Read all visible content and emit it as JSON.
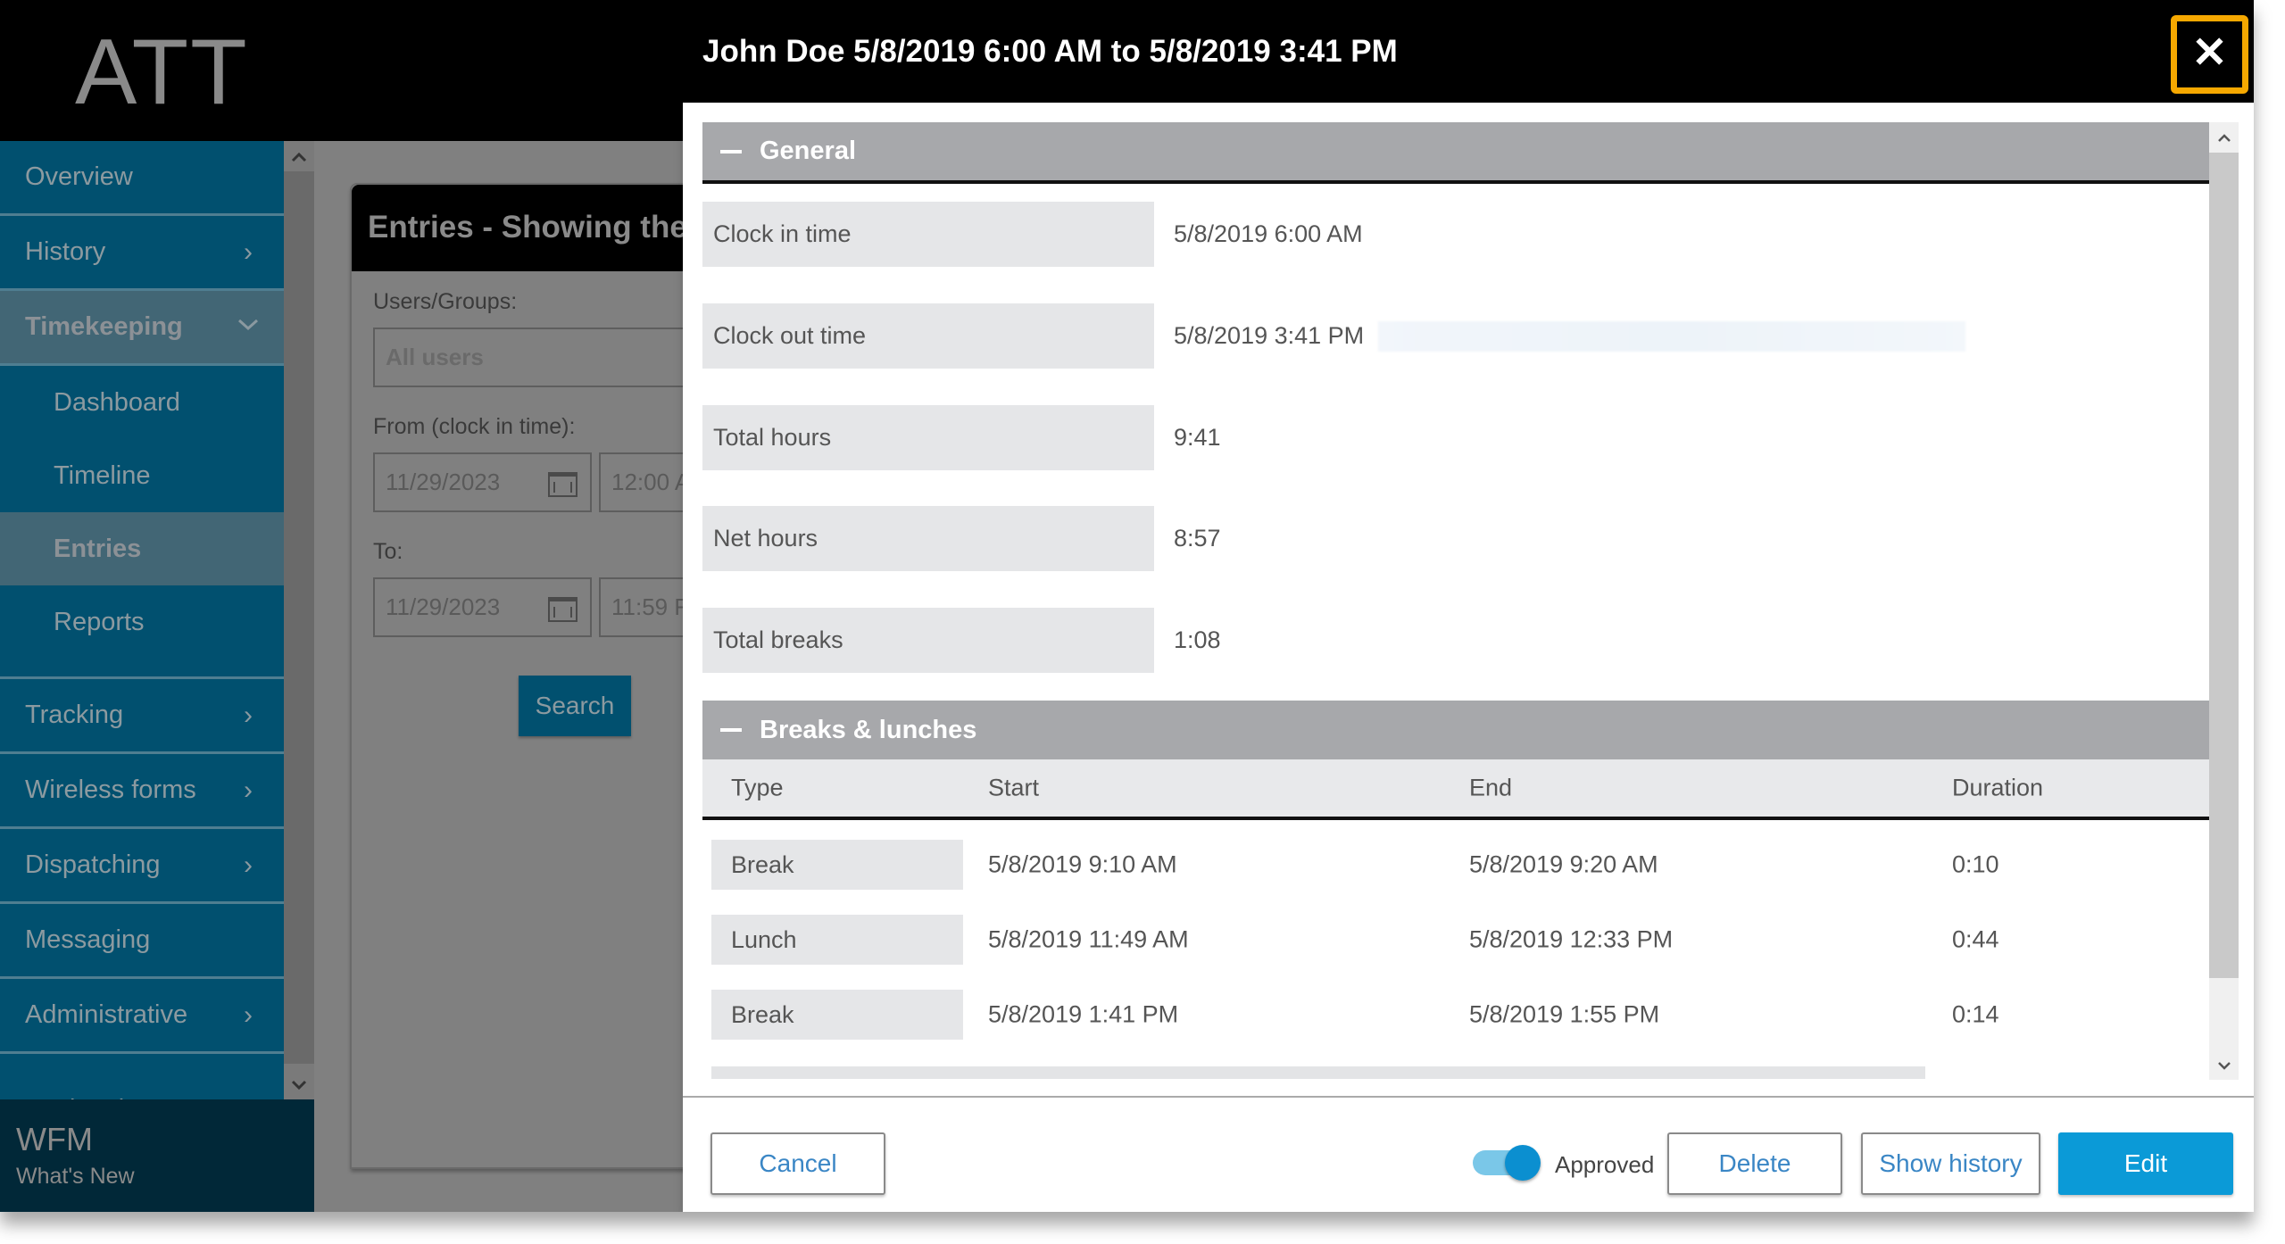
{
  "app": {
    "logo": "ATT",
    "footer_brand": "WFM",
    "footer_link": "What's New"
  },
  "sidebar": {
    "items": [
      {
        "label": "Overview",
        "chevron": "none"
      },
      {
        "label": "History",
        "chevron": "chevron-right"
      },
      {
        "label": "Timekeeping",
        "chevron": "chevron-down",
        "active": true
      },
      {
        "label": "Tracking",
        "chevron": "chevron-right"
      },
      {
        "label": "Wireless forms",
        "chevron": "chevron-right"
      },
      {
        "label": "Dispatching",
        "chevron": "chevron-right"
      },
      {
        "label": "Messaging",
        "chevron": "none"
      },
      {
        "label": "Administrative",
        "chevron": "chevron-right"
      },
      {
        "label": "Marketplace",
        "chevron": "none"
      }
    ],
    "sub_items": [
      {
        "label": "Dashboard"
      },
      {
        "label": "Timeline"
      },
      {
        "label": "Entries",
        "active": true
      },
      {
        "label": "Reports"
      }
    ],
    "chevron_right_glyph": "›",
    "chevron_down_glyph": "⌄"
  },
  "entries_panel": {
    "title": "Entries - Showing the",
    "users_label": "Users/Groups:",
    "users_value": "All users",
    "from_label": "From (clock in time):",
    "from_date": "11/29/2023",
    "from_time": "12:00 A",
    "to_label": "To:",
    "to_date": "11/29/2023",
    "to_time": "11:59 F",
    "search_label": "Search"
  },
  "modal": {
    "title": "John Doe 5/8/2019 6:00 AM to 5/8/2019 3:41 PM",
    "close_glyph": "✕",
    "highlight_color": "#f6a800",
    "general": {
      "title": "General",
      "rows": [
        {
          "label": "Clock in time",
          "value": "5/8/2019 6:00 AM"
        },
        {
          "label": "Clock out time",
          "value": "5/8/2019 3:41 PM"
        },
        {
          "label": "Total hours",
          "value": "9:41"
        },
        {
          "label": "Net hours",
          "value": "8:57"
        },
        {
          "label": "Total breaks",
          "value": "1:08"
        }
      ]
    },
    "breaks": {
      "title": "Breaks & lunches",
      "columns": [
        "Type",
        "Start",
        "End",
        "Duration"
      ],
      "rows": [
        {
          "type": "Break",
          "start": "5/8/2019 9:10 AM",
          "end": "5/8/2019 9:20 AM",
          "duration": "0:10"
        },
        {
          "type": "Lunch",
          "start": "5/8/2019 11:49 AM",
          "end": "5/8/2019 12:33 PM",
          "duration": "0:44"
        },
        {
          "type": "Break",
          "start": "5/8/2019 1:41 PM",
          "end": "5/8/2019 1:55 PM",
          "duration": "0:14"
        }
      ]
    },
    "footer": {
      "cancel": "Cancel",
      "approved_label": "Approved",
      "approved": true,
      "delete": "Delete",
      "show_history": "Show history",
      "edit": "Edit"
    },
    "accent_color": "#0b9ad7"
  }
}
